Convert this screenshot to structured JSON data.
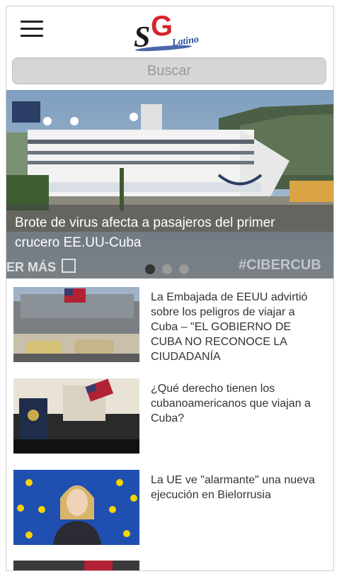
{
  "header": {
    "menu_icon": "hamburger-menu-icon",
    "logo_text": "SG",
    "logo_subtext": "Latino"
  },
  "search": {
    "placeholder": "Buscar",
    "value": ""
  },
  "hero": {
    "title": "Brote de virus afecta a pasajeros del primer crucero EE.UU-Cuba",
    "ver_mas": "ER MÁS",
    "watermark": "#CIBERCUB",
    "slides": 3,
    "active_slide": 1
  },
  "news": [
    {
      "title": "La Embajada de EEUU advirtió sobre los peligros de viajar a Cuba – \"EL GOBIERNO DE CUBA NO RECONOCE LA CIUDADANÍA"
    },
    {
      "title": "¿Qué derecho tienen los cubanoamericanos que viajan a Cuba?"
    },
    {
      "title": "La UE ve \"alarmante\" una nueva ejecución en Bielorrusia"
    }
  ],
  "colors": {
    "logo_red": "#d8232a",
    "logo_blue": "#2a4f9c",
    "search_bg": "#d6d6d6",
    "text": "#333333"
  }
}
